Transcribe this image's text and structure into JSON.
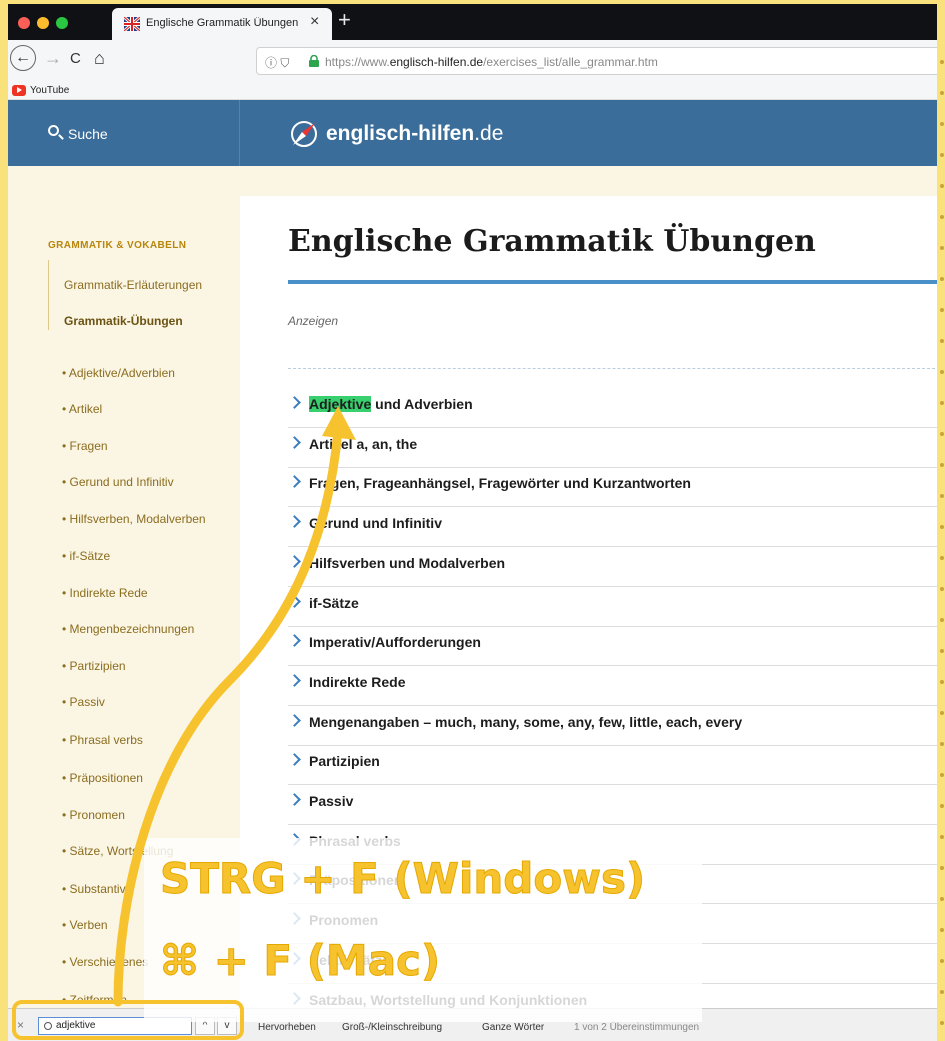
{
  "browser": {
    "tab_title": "Englische Grammatik Übungen",
    "tab_close": "×",
    "new_tab": "+",
    "url_prefix": "https://www.",
    "url_domain": "englisch-hilfen.de",
    "url_path": "/exercises_list/alle_grammar.htm",
    "bookmark_youtube": "YouTube",
    "nav_icons": {
      "back": "←",
      "forward": "→",
      "reload": "C",
      "home": "⌂",
      "info": "ⓘ ⛉"
    }
  },
  "site": {
    "search_label": "Suche",
    "logo_name": "englisch-hilfen",
    "logo_tld": ".de"
  },
  "sidebar": {
    "heading": "GRAMMATIK & VOKABELN",
    "main_items": [
      "Grammatik-Erläuterungen",
      "Grammatik-Übungen"
    ],
    "sub_items": [
      "Adjektive/Adverbien",
      "Artikel",
      "Fragen",
      "Gerund und Infinitiv",
      "Hilfsverben, Modalverben",
      "if-Sätze",
      "Indirekte Rede",
      "Mengenbezeichnungen",
      "Partizipien",
      "Passiv",
      "Phrasal verbs",
      "Präpositionen",
      "Pronomen",
      "Sätze, Wortstellung",
      "Substantive",
      "Verben",
      "Verschiedenes",
      "Zeitformen"
    ]
  },
  "main": {
    "title": "Englische Grammatik Übungen",
    "ads_label": "Anzeigen",
    "topic_highlight": "Adjektive",
    "topics": [
      "Adjektive und Adverbien",
      "Artikel a, an, the",
      "Fragen, Frageanhängsel, Fragewörter und Kurzantworten",
      "Gerund und Infinitiv",
      "Hilfsverben und Modalverben",
      "if-Sätze",
      "Imperativ/Aufforderungen",
      "Indirekte Rede",
      "Mengenangaben – much, many, some, any, few, little, each, every",
      "Partizipien",
      "Passiv",
      "Phrasal verbs",
      "Präpositionen",
      "Pronomen",
      "Relativsätze",
      "Satzbau, Wortstellung und Konjunktionen"
    ]
  },
  "findbar": {
    "close": "×",
    "query": "adjektive",
    "prev": "^",
    "next": "v",
    "options": [
      "Hervorheben",
      "Groß-/Kleinschreibung",
      "Ganze Wörter"
    ],
    "status": "1 von 2 Übereinstimmungen"
  },
  "annotation": {
    "line1": "STRG + F (Windows)",
    "line2": "⌘ + F (Mac)"
  },
  "colors": {
    "accent": "#3b6d9a",
    "highlight": "#38d06e",
    "annotation": "#f6c32e"
  }
}
